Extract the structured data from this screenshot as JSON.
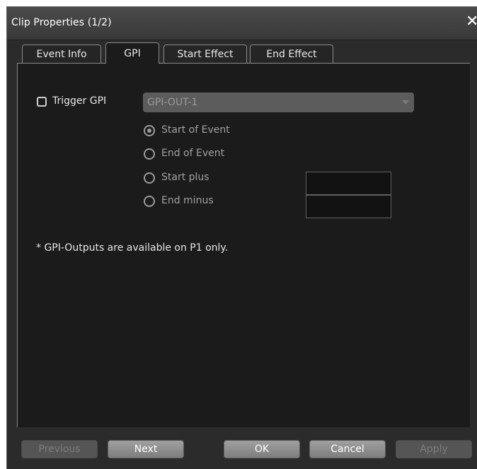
{
  "window": {
    "title": "Clip Properties (1/2)",
    "close_glyph": "✕"
  },
  "tabs": [
    {
      "label": "Event Info",
      "active": false
    },
    {
      "label": "GPI",
      "active": true
    },
    {
      "label": "Start Effect",
      "active": false
    },
    {
      "label": "End Effect",
      "active": false
    }
  ],
  "gpi": {
    "trigger_label": "Trigger GPI",
    "trigger_checked": false,
    "output_select_value": "GPI-OUT-1",
    "options": [
      {
        "label": "Start of Event",
        "selected": true
      },
      {
        "label": "End of Event",
        "selected": false
      },
      {
        "label": "Start plus",
        "selected": false
      },
      {
        "label": "End minus",
        "selected": false
      }
    ],
    "start_plus_value": "",
    "end_minus_value": "",
    "note": "* GPI-Outputs are available on P1 only."
  },
  "buttons": {
    "previous": "Previous",
    "next": "Next",
    "ok": "OK",
    "cancel": "Cancel",
    "apply": "Apply"
  },
  "colors": {
    "background": "#2b2b2b",
    "panel": "#1b1b1b",
    "disabled_text": "#a0a0a0"
  }
}
